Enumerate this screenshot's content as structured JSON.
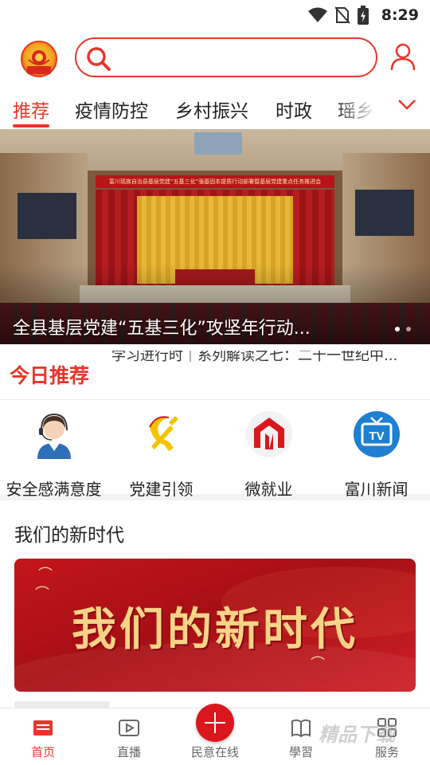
{
  "status_bar": {
    "time": "8:29",
    "icons": [
      "wifi-icon",
      "no-sim-icon",
      "battery-charging-icon"
    ]
  },
  "header": {
    "logo": "app-logo",
    "search": {
      "placeholder": "",
      "value": ""
    },
    "user_icon": "user-icon"
  },
  "tabs": {
    "items": [
      {
        "label": "推荐",
        "active": true
      },
      {
        "label": "疫情防控",
        "active": false
      },
      {
        "label": "乡村振兴",
        "active": false
      },
      {
        "label": "时政",
        "active": false
      },
      {
        "label": "瑶乡",
        "active": false
      }
    ],
    "more_icon": "chevron-down-icon"
  },
  "banner": {
    "caption": "全县基层党建“五基三化”攻坚年行动...",
    "stage_title": "富川瑶族自治县基层党建“五基三化”强基固本提质行动部署暨基层党建重点任务推进会",
    "active_index": 0,
    "total": 2
  },
  "today": {
    "label": "今日推荐",
    "ticker": "学习进行时｜系列解读之七：二十一世纪中..."
  },
  "quick_services": [
    {
      "label": "安全感满意度",
      "icon": "customer-service-icon"
    },
    {
      "label": "党建引领",
      "icon": "party-emblem-icon"
    },
    {
      "label": "微就业",
      "icon": "employment-icon"
    },
    {
      "label": "富川新闻",
      "icon": "tv-icon"
    }
  ],
  "section": {
    "title": "我们的新时代",
    "feature_text": "我们的新时代"
  },
  "bottom_nav": [
    {
      "label": "首页",
      "icon": "home-news-icon",
      "active": true
    },
    {
      "label": "直播",
      "icon": "live-play-icon",
      "active": false
    },
    {
      "label": "民意在线",
      "icon": "plus-icon",
      "active": false
    },
    {
      "label": "學習",
      "icon": "book-icon",
      "active": false
    },
    {
      "label": "服务",
      "icon": "grid-icon",
      "active": false
    }
  ],
  "watermark": "精品下载",
  "colors": {
    "accent": "#e8362b",
    "nav_center": "#d9181e",
    "feature_bg": "#b5151b",
    "feature_text": "#f6d487"
  }
}
